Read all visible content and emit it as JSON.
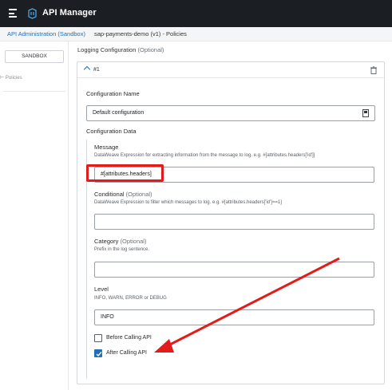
{
  "header": {
    "app_title": "API Manager"
  },
  "breadcrumb": {
    "root": "API Administration (Sandbox)",
    "current": "sap-payments-demo (v1) - Policies"
  },
  "sidebar": {
    "environment_button": "SANDBOX",
    "policies_item": "⊢ Policies"
  },
  "section": {
    "title": "Logging Configuration",
    "title_optional": "(Optional)"
  },
  "panel": {
    "number": "#1",
    "config_name": {
      "label": "Configuration Name",
      "value": "Default configuration"
    },
    "config_data_label": "Configuration Data",
    "message": {
      "label": "Message",
      "help": "DataWeave Expression for extracting information from the message to log. e.g. #[attributes.headers['id']]",
      "value": "#[attributes.headers]"
    },
    "conditional": {
      "label": "Conditional",
      "optional": "(Optional)",
      "help": "DataWeave Expression to filter which messages to log. e.g. #[attributes.headers['id']==1]",
      "value": ""
    },
    "category": {
      "label": "Category",
      "optional": "(Optional)",
      "help": "Prefix in the log sentence.",
      "value": ""
    },
    "level": {
      "label": "Level",
      "help": "INFO, WARN, ERROR or DEBUG",
      "value": "INFO"
    },
    "before_calling": {
      "label": "Before Calling API",
      "checked": false
    },
    "after_calling": {
      "label": "After Calling API",
      "checked": true
    }
  },
  "colors": {
    "topbar": "#1b1f24",
    "link": "#1f6fb7",
    "highlight": "#e21b1b",
    "arrow": "#e21b1b"
  }
}
